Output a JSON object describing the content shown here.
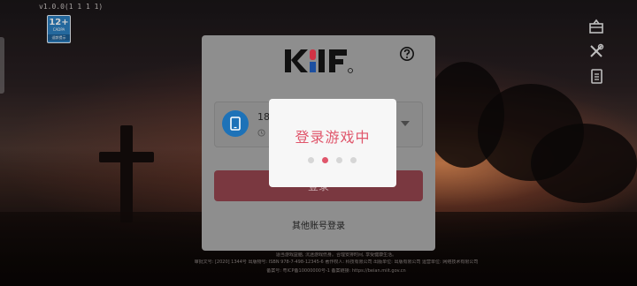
{
  "app": {
    "version": "v1.0.0(1 1 1 1)"
  },
  "age_rating": {
    "label": "12+",
    "sub1": "CADPA",
    "sub2": "适龄提示"
  },
  "side_icons": [
    "notice-board-icon",
    "tools-icon",
    "clipboard-icon"
  ],
  "login_panel": {
    "logo_text": "KHF",
    "account": {
      "number_partial": "18",
      "icon": "phone-icon"
    },
    "login_button_label": "登录",
    "other_login_label": "其他账号登录"
  },
  "loading_modal": {
    "title": "登录游戏中",
    "dots": 4,
    "active_dot": 1,
    "active_color": "#e0566b"
  },
  "legal": {
    "line1": "                                                                                                                          科技有限公司, 版权保护文化。",
    "line2": "                                                                                                           适当游戏益脑, 沉迷游戏伤身。合理安排时间, 享受健康生活。",
    "line3": "审批文号: [2020] 1344号 出版物号: ISBN 978-7-498-12345-6 著作权人: 科技有限公司 出版单位: 出版有限公司 运营单位: 网络技术有限公司",
    "line4": "备案号: 粤ICP备10000000号-1  备案链接: https://beian.miit.gov.cn"
  },
  "colors": {
    "brand_red": "#e0566b",
    "button_dim": "#7a3840",
    "phone_blue": "#1d72b8"
  }
}
